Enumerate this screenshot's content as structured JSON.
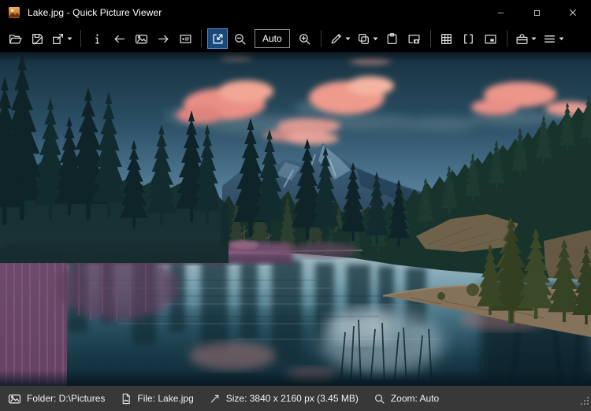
{
  "window": {
    "title": "Lake.jpg - Quick Picture Viewer",
    "app_icon": "landscape-thumbnail-icon"
  },
  "titlebar_controls": [
    {
      "name": "minimize",
      "icon": "minimize-icon"
    },
    {
      "name": "maximize",
      "icon": "maximize-icon"
    },
    {
      "name": "close",
      "icon": "close-icon"
    }
  ],
  "toolbar": {
    "groups": [
      {
        "items": [
          {
            "name": "open",
            "icon": "folder-open-icon"
          },
          {
            "name": "save-as",
            "icon": "save-icon"
          },
          {
            "name": "export",
            "icon": "export-icon",
            "dropdown": true
          }
        ]
      },
      {
        "items": [
          {
            "name": "image-info",
            "icon": "info-icon"
          },
          {
            "name": "previous-image",
            "icon": "arrow-left-icon"
          },
          {
            "name": "image-browser",
            "icon": "picture-icon"
          },
          {
            "name": "next-image",
            "icon": "arrow-right-icon"
          },
          {
            "name": "slideshow",
            "icon": "slideshow-icon"
          }
        ]
      },
      {
        "items": [
          {
            "name": "auto-zoom",
            "icon": "auto-zoom-icon",
            "active": true
          },
          {
            "name": "zoom-out",
            "icon": "zoom-out-icon"
          },
          {
            "name": "zoom-level",
            "type": "labelbutton",
            "label": "Auto"
          },
          {
            "name": "zoom-in",
            "icon": "zoom-in-icon"
          }
        ]
      },
      {
        "items": [
          {
            "name": "edit",
            "icon": "pencil-icon",
            "dropdown": true
          },
          {
            "name": "copy",
            "icon": "copy-icon",
            "dropdown": true
          },
          {
            "name": "paste",
            "icon": "paste-icon"
          },
          {
            "name": "snapshot",
            "icon": "snapshot-icon"
          }
        ]
      },
      {
        "items": [
          {
            "name": "checkerboard-background",
            "icon": "grid-icon"
          },
          {
            "name": "fullscreen",
            "icon": "fullscreen-icon"
          },
          {
            "name": "picture-in-picture",
            "icon": "pip-icon"
          }
        ]
      },
      {
        "items": [
          {
            "name": "tools",
            "icon": "toolbox-icon",
            "dropdown": true
          },
          {
            "name": "main-menu",
            "icon": "menu-icon",
            "dropdown": true
          }
        ]
      }
    ]
  },
  "image": {
    "description": "Lake with pine forest, mountain and pink sunset clouds reflected in still water",
    "filename": "Lake.jpg"
  },
  "statusbar": {
    "items": [
      {
        "name": "folder",
        "icon": "picture-icon",
        "label": "Folder: D:\\Pictures"
      },
      {
        "name": "file",
        "icon": "file-image-icon",
        "label": "File: Lake.jpg"
      },
      {
        "name": "size",
        "icon": "diagonal-arrow-icon",
        "label": "Size: 3840 x 2160 px (3.45 MB)"
      },
      {
        "name": "zoom",
        "icon": "magnifier-icon",
        "label": "Zoom: Auto"
      }
    ]
  },
  "colors": {
    "chrome_bg": "#000000",
    "statusbar_bg": "#383838",
    "selected_button_bg": "#17497c",
    "selected_button_border": "#4f90d2",
    "text": "#ffffff",
    "icon": "#d6d6d6"
  }
}
